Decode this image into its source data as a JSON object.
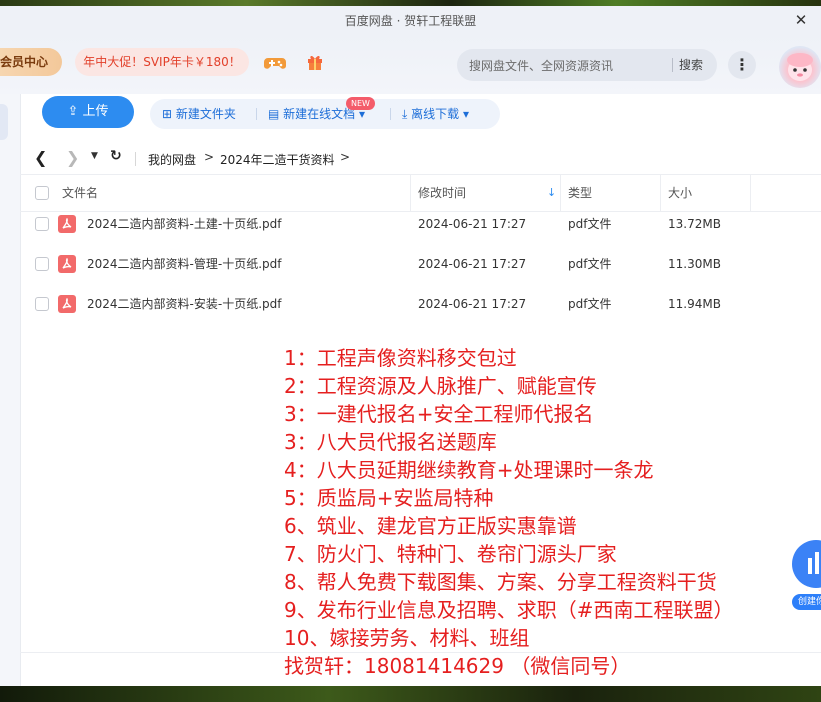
{
  "window": {
    "title": "百度网盘 · 贺轩工程联盟",
    "close_glyph": "✕"
  },
  "header": {
    "vip_center": "会员中心",
    "promo": "年中大促！SVIP年卡￥180！",
    "search_placeholder": "搜网盘文件、全网资源资讯",
    "search_button": "搜索",
    "more_glyph": "⋮"
  },
  "toolbar": {
    "upload": "上传",
    "new_folder": "新建文件夹",
    "new_online_doc": "新建在线文档",
    "new_badge": "NEW",
    "offline_download": "离线下载"
  },
  "breadcrumb": {
    "root": "我的网盘",
    "folder": "2024年二造干货资料",
    "arrow": ">"
  },
  "table": {
    "headers": {
      "name": "文件名",
      "modified": "修改时间",
      "type": "类型",
      "size": "大小"
    },
    "rows": [
      {
        "name": "2024二造内部资料-土建-十页纸.pdf",
        "modified": "2024-06-21 17:27",
        "type": "pdf文件",
        "size": "13.72MB"
      },
      {
        "name": "2024二造内部资料-管理-十页纸.pdf",
        "modified": "2024-06-21 17:27",
        "type": "pdf文件",
        "size": "11.30MB"
      },
      {
        "name": "2024二造内部资料-安装-十页纸.pdf",
        "modified": "2024-06-21 17:27",
        "type": "pdf文件",
        "size": "11.94MB"
      }
    ]
  },
  "overlay_lines": [
    "1：工程声像资料移交包过",
    "2：工程资源及人脉推广、赋能宣传",
    "3：一建代报名+安全工程师代报名",
    "3：八大员代报名送题库",
    "4：八大员延期继续教育+处理课时一条龙",
    "5：质监局+安监局特种",
    "6、筑业、建龙官方正版实惠靠谱",
    "7、防火门、特种门、卷帘门源头厂家",
    "8、帮人免费下载图集、方案、分享工程资料干货",
    "9、发布行业信息及招聘、求职（#西南工程联盟）",
    "10、嫁接劳务、材料、班组",
    "找贺轩：18081414629 （微信同号）"
  ],
  "widget_label": "创建你",
  "colors": {
    "accent": "#2d8cf0",
    "overlay_text": "#e51f1f",
    "pdf": "#f26a6a"
  }
}
